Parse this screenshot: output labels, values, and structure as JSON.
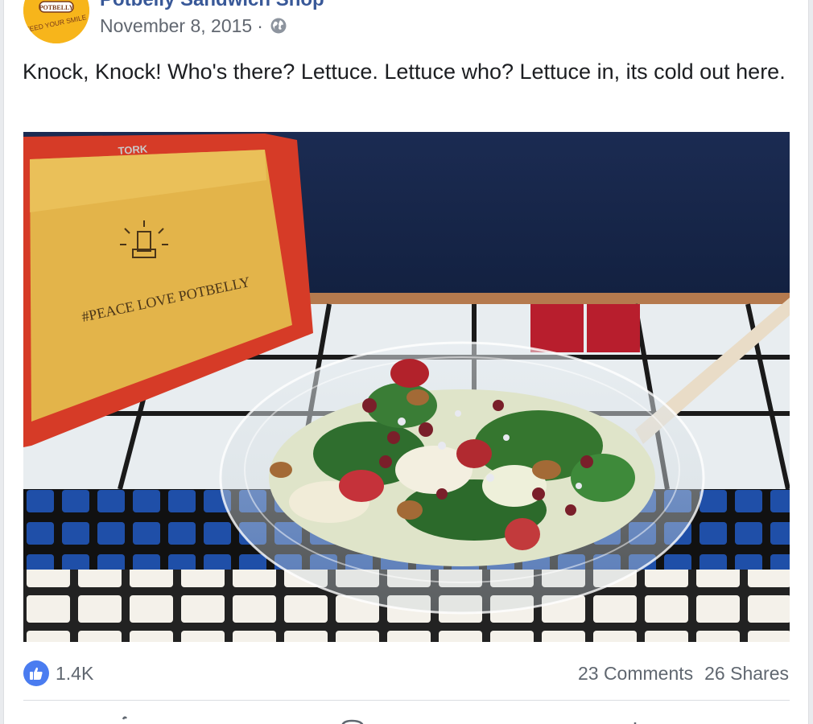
{
  "post": {
    "page_name": "Potbelly Sandwich Shop",
    "date": "November 8, 2015",
    "separator": "·",
    "privacy_icon": "globe-icon",
    "text": "Knock, Knock! Who's there? Lettuce. Lettuce who? Lettuce in, its cold out here."
  },
  "avatar": {
    "brand_text": "POTBELLY",
    "slogan": "FEED YOUR SMILE"
  },
  "photo": {
    "napkin_brand": "TORK",
    "napkin_slogan": "#PEACE LOVE POTBELLY"
  },
  "footer": {
    "like_icon": "thumbs-up-icon",
    "like_count": "1.4K",
    "comments": "23 Comments",
    "shares": "26 Shares"
  },
  "colors": {
    "link_blue": "#385898",
    "like_blue": "#4a7cf0",
    "meta_gray": "#616770",
    "avatar_yellow": "#f7b51b"
  }
}
